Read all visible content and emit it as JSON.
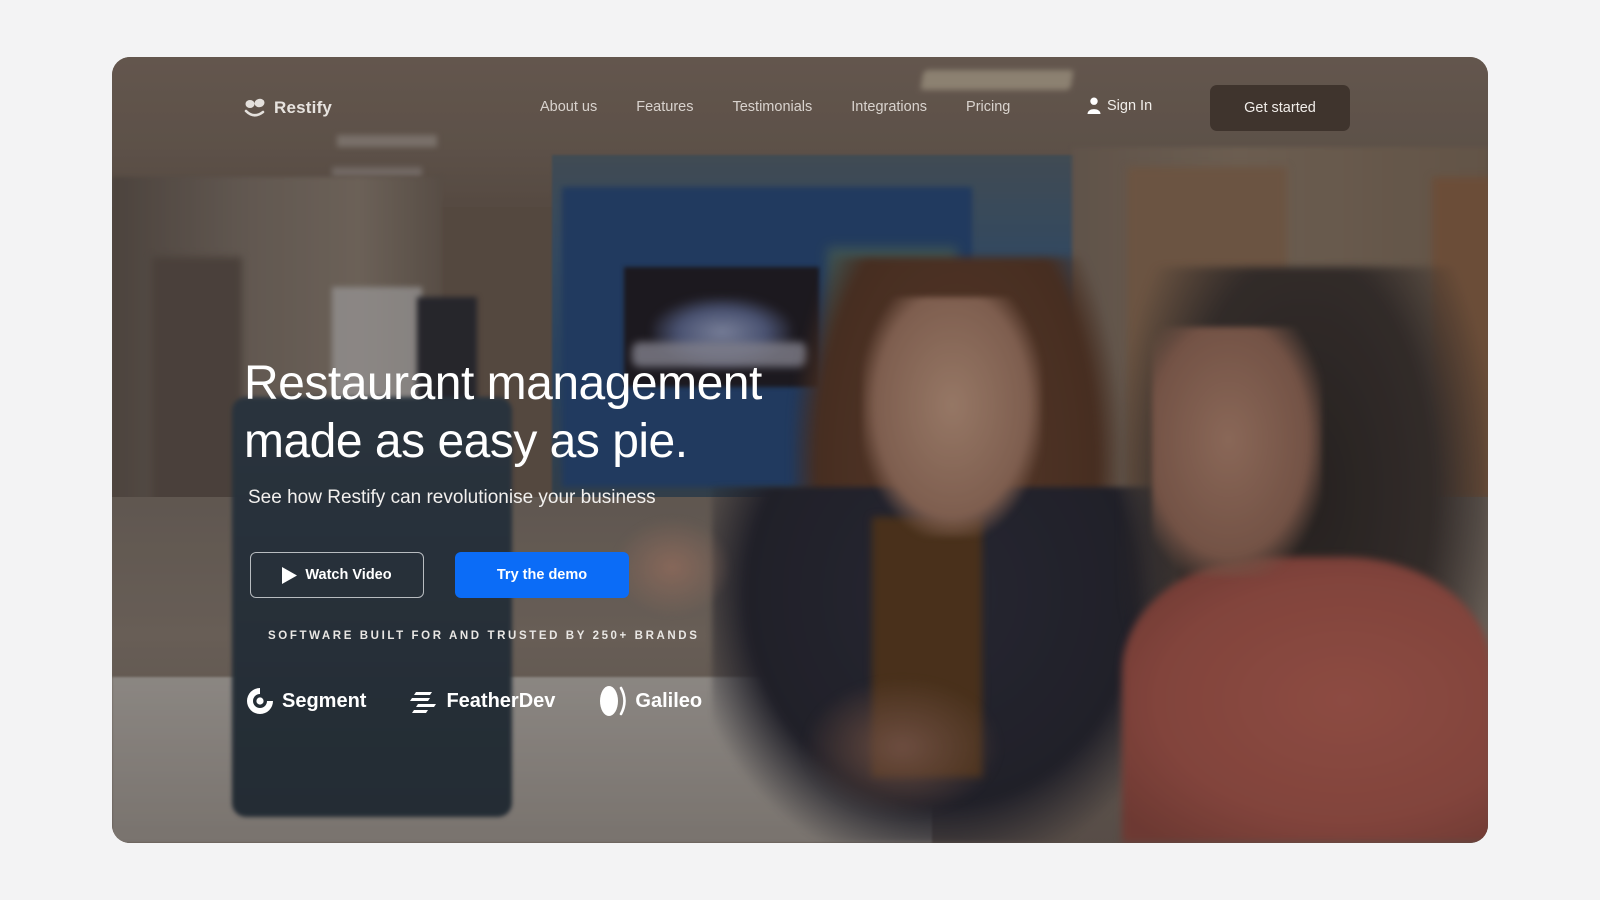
{
  "nav": {
    "logo": {
      "icon": "smile-face-logo-icon",
      "text": "Restify"
    },
    "links": [
      {
        "label": "About us"
      },
      {
        "label": "Features"
      },
      {
        "label": "Testimonials"
      },
      {
        "label": "Integrations"
      },
      {
        "label": "Pricing"
      }
    ],
    "sign_in": {
      "icon": "user-icon",
      "label": "Sign In"
    },
    "cta": {
      "label": "Get started"
    }
  },
  "hero": {
    "headline_line1": "Restaurant management",
    "headline_line2": "made as easy as pie.",
    "subheadline": "See how Restify can revolutionise your business",
    "watch_video": {
      "icon": "play-icon",
      "label": "Watch Video"
    },
    "try_demo": {
      "label": "Try  the demo"
    },
    "trusted_text": "SOFTWARE BUILT FOR AND TRUSTED BY 250+ BRANDS",
    "brands": [
      {
        "name": "Segment",
        "icon": "segment-logo-icon"
      },
      {
        "name": "FeatherDev",
        "icon": "featherdev-logo-icon"
      },
      {
        "name": "Galileo",
        "icon": "galileo-logo-icon"
      }
    ]
  },
  "colors": {
    "primary_button": "#0b6cf7",
    "page_background": "#f3f3f4",
    "text_on_image": "#ffffff"
  }
}
